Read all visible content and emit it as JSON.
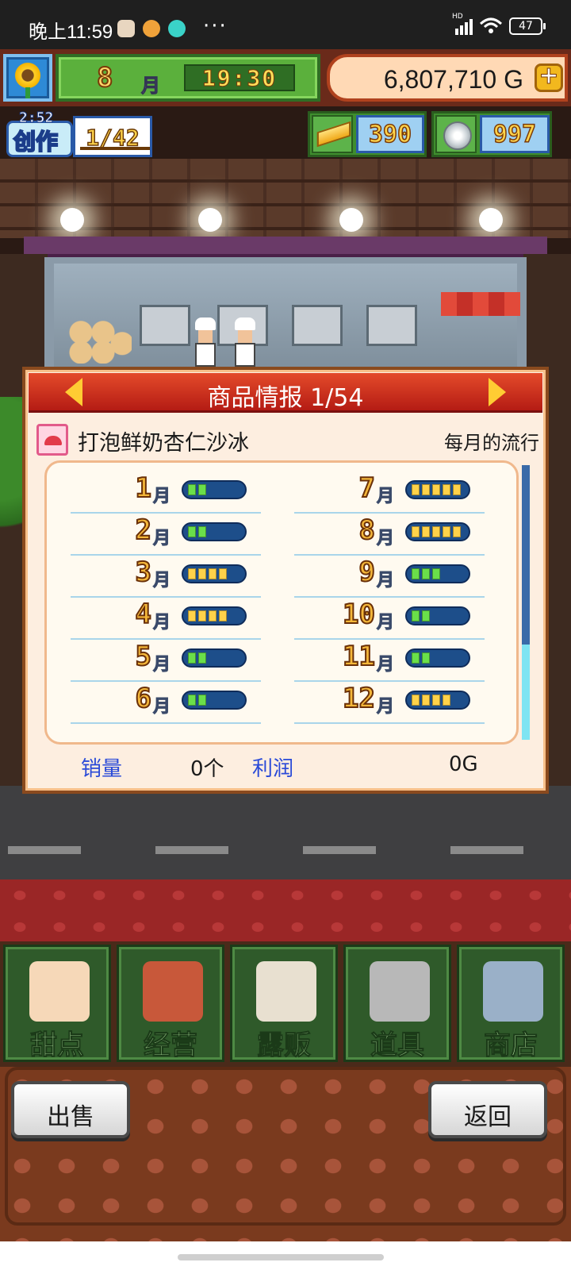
{
  "statusbar": {
    "time": "晚上11:59",
    "dots": "···",
    "battery": "47",
    "hd_label": "HD"
  },
  "hud": {
    "month_number": "8",
    "month_suffix": "月",
    "clock": "19:30",
    "money": "6,807,710 G",
    "plus_label": "+"
  },
  "creation": {
    "timer": "2:52",
    "label": "创作",
    "count": "1/42"
  },
  "resources": {
    "gold_bars": "390",
    "silver_medals": "997"
  },
  "dialog": {
    "title": "商品情报 1/54",
    "product_name": "打泡鲜奶杏仁沙冰",
    "trend_label": "每月的流行",
    "months": [
      {
        "num": "1",
        "suffix": "月",
        "level": 2,
        "color": "green"
      },
      {
        "num": "2",
        "suffix": "月",
        "level": 2,
        "color": "green"
      },
      {
        "num": "3",
        "suffix": "月",
        "level": 4,
        "color": "yellow"
      },
      {
        "num": "4",
        "suffix": "月",
        "level": 4,
        "color": "yellow"
      },
      {
        "num": "5",
        "suffix": "月",
        "level": 2,
        "color": "green"
      },
      {
        "num": "6",
        "suffix": "月",
        "level": 2,
        "color": "green"
      },
      {
        "num": "7",
        "suffix": "月",
        "level": 5,
        "color": "yellow"
      },
      {
        "num": "8",
        "suffix": "月",
        "level": 5,
        "color": "yellow"
      },
      {
        "num": "9",
        "suffix": "月",
        "level": 3,
        "color": "green"
      },
      {
        "num": "10",
        "suffix": "月",
        "level": 2,
        "color": "green"
      },
      {
        "num": "11",
        "suffix": "月",
        "level": 2,
        "color": "green"
      },
      {
        "num": "12",
        "suffix": "月",
        "level": 4,
        "color": "yellow"
      }
    ],
    "sales_label": "销量",
    "sales_value": "0个",
    "profit_label": "利润",
    "profit_value": "0G"
  },
  "nav": {
    "items": [
      {
        "label": "甜点",
        "icon": "cake-icon"
      },
      {
        "label": "经营",
        "icon": "shop-building-icon"
      },
      {
        "label": "露贩",
        "icon": "food-truck-icon"
      },
      {
        "label": "道具",
        "icon": "gear-bag-icon"
      },
      {
        "label": "商店",
        "icon": "shopping-cart-icon"
      }
    ]
  },
  "actions": {
    "sell_label": "出售",
    "back_label": "返回"
  },
  "colors": {
    "header_red": "#c8281c",
    "bar_green": "#6adf4a",
    "bar_yellow": "#ffd24a",
    "stat_label_blue": "#2a4ad8",
    "nav_green": "#2f5a2a"
  }
}
